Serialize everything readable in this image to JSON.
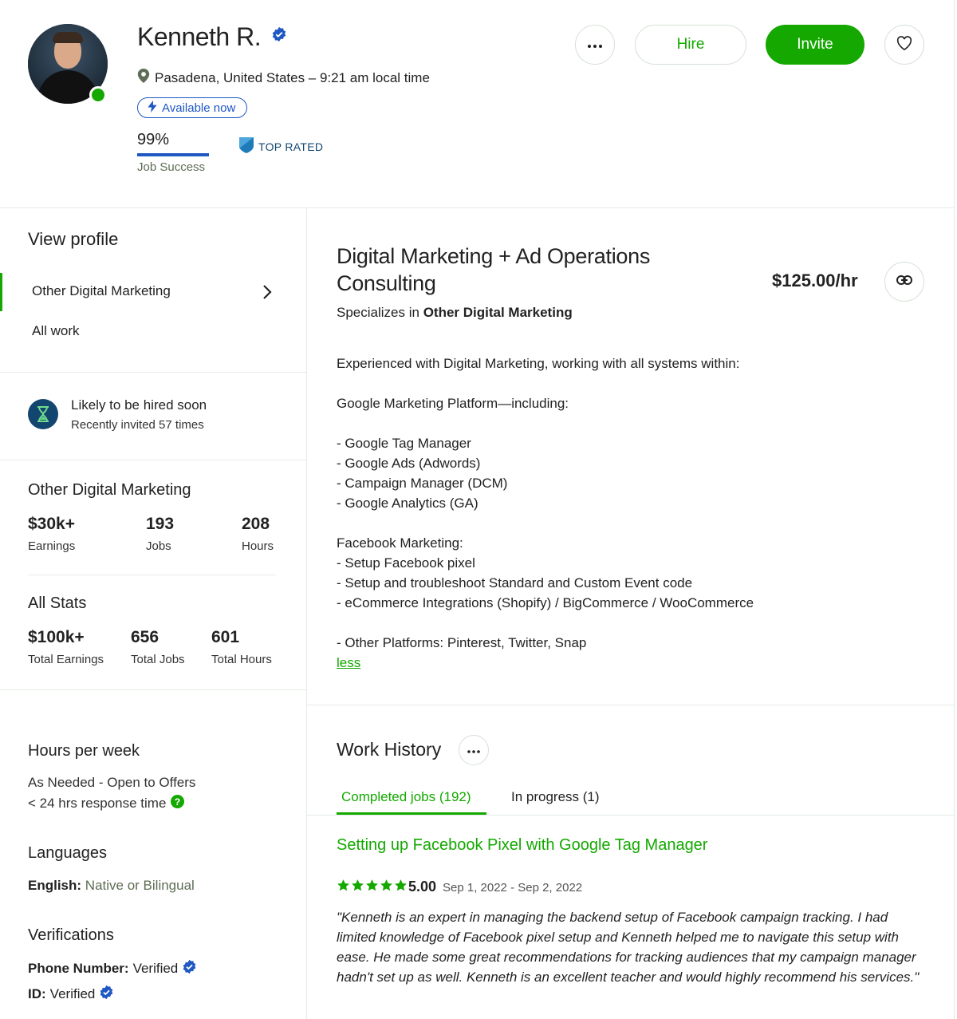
{
  "header": {
    "name": "Kenneth R.",
    "location": "Pasadena, United States – 9:21 am local time",
    "availability": "Available now",
    "job_success_value": "99%",
    "job_success_label": "Job Success",
    "job_success_fraction": 0.99,
    "top_rated": "TOP RATED",
    "hire_label": "Hire",
    "invite_label": "Invite"
  },
  "sidebar": {
    "view_profile": "View profile",
    "nav": [
      "Other Digital Marketing",
      "All work"
    ],
    "likely_title": "Likely to be hired soon",
    "likely_sub": "Recently invited 57 times",
    "category_title": "Other Digital Marketing",
    "category_stats": [
      {
        "value": "$30k+",
        "label": "Earnings"
      },
      {
        "value": "193",
        "label": "Jobs"
      },
      {
        "value": "208",
        "label": "Hours"
      }
    ],
    "all_stats_title": "All Stats",
    "all_stats": [
      {
        "value": "$100k+",
        "label": "Total Earnings"
      },
      {
        "value": "656",
        "label": "Total Jobs"
      },
      {
        "value": "601",
        "label": "Total Hours"
      }
    ],
    "hours_title": "Hours per week",
    "hours_value": "As Needed - Open to Offers",
    "response_time": "< 24 hrs response time",
    "languages_title": "Languages",
    "language_name": "English:",
    "language_level": "Native or Bilingual",
    "verifications_title": "Verifications",
    "verif_phone_label": "Phone Number:",
    "verif_phone_value": "Verified",
    "verif_id_label": "ID:",
    "verif_id_value": "Verified"
  },
  "main": {
    "title": "Digital Marketing + Ad Operations Consulting",
    "rate": "$125.00/hr",
    "specializes_prefix": "Specializes in",
    "specializes_value": "Other Digital Marketing",
    "description_lines": [
      "Experienced with Digital Marketing, working with all systems within:",
      "",
      "Google Marketing Platform—including:",
      "",
      "- Google Tag Manager",
      "- Google Ads (Adwords)",
      "- Campaign Manager (DCM)",
      "- Google Analytics (GA)",
      "",
      "Facebook Marketing:",
      "- Setup Facebook pixel",
      "- Setup and troubleshoot Standard and Custom Event code",
      "- eCommerce Integrations (Shopify) / BigCommerce / WooCommerce",
      "",
      "- Other Platforms: Pinterest, Twitter, Snap"
    ],
    "less_label": "less",
    "work_history_title": "Work History",
    "tabs": [
      "Completed jobs (192)",
      "In progress (1)"
    ],
    "job": {
      "title": "Setting up Facebook Pixel with Google Tag Manager",
      "rating": "5.00",
      "stars": 5,
      "dates": "Sep 1, 2022 - Sep 2, 2022",
      "review": "\"Kenneth is an expert in managing the backend setup of Facebook campaign tracking. I had limited knowledge of Facebook pixel setup and Kenneth helped me to navigate this setup with ease. He made some great recommendations for tracking audiences that my campaign manager hadn't set up as well. Kenneth is an excellent teacher and would highly recommend his services.\""
    }
  },
  "colors": {
    "brand_green": "#14a800",
    "blue": "#1f57c3",
    "navy": "#13466e"
  },
  "icons": [
    "verified-icon",
    "location-pin-icon",
    "lightning-icon",
    "top-rated-shield-icon",
    "more-dots-icon",
    "heart-icon",
    "chevron-right-icon",
    "hourglass-icon",
    "link-icon",
    "question-icon",
    "star-icon"
  ]
}
